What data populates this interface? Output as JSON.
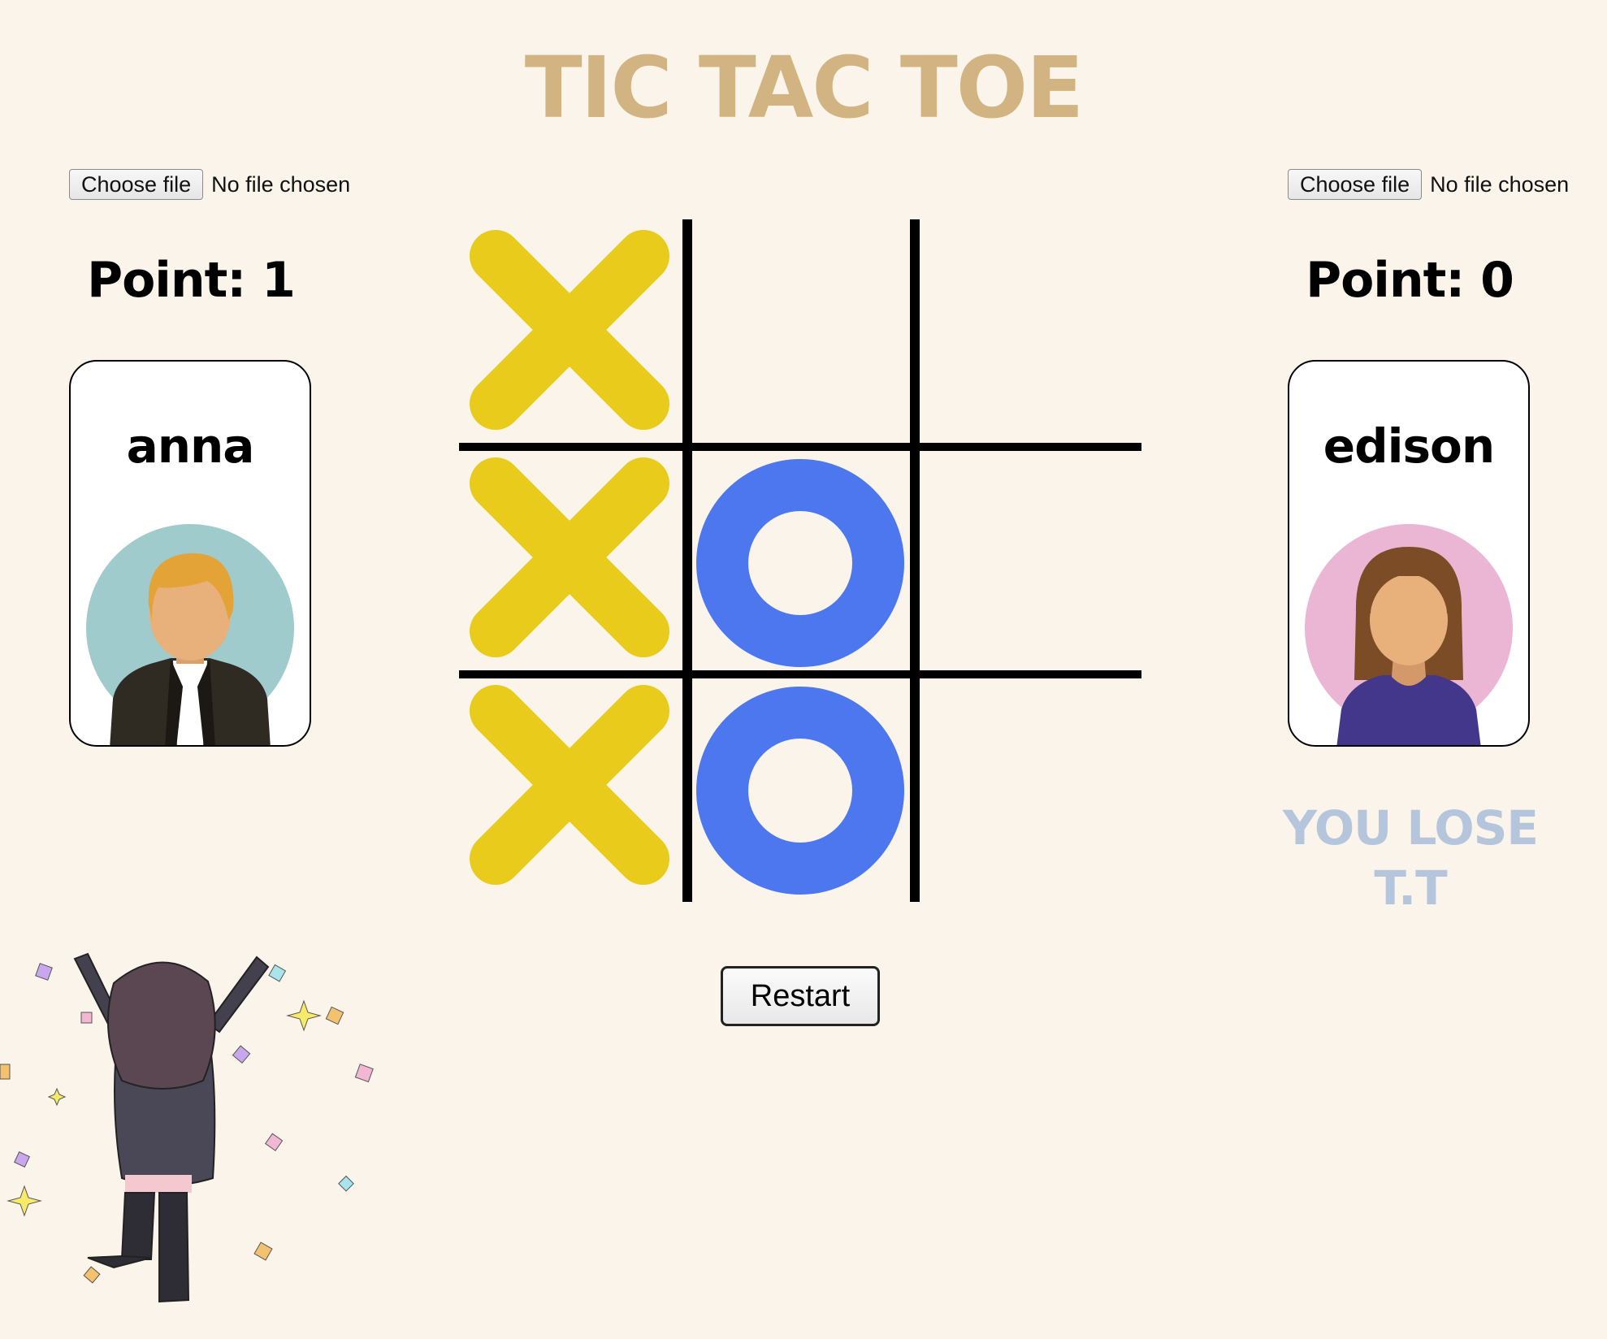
{
  "title": "TIC TAC TOE",
  "colors": {
    "background": "#faf4ea",
    "title": "#d2b483",
    "x_mark": "#e8cb1b",
    "o_mark": "#4c77ef",
    "result_text": "#b4c5dc"
  },
  "file_input": {
    "button_label": "Choose file",
    "status": "No file chosen"
  },
  "players": [
    {
      "name": "anna",
      "points_text": "Point: 1",
      "avatar": "male-avatar",
      "avatar_bg": "#a0cbcd"
    },
    {
      "name": "edison",
      "points_text": "Point: 0",
      "avatar": "female-avatar",
      "avatar_bg": "#ebb6d4",
      "result": [
        "YOU LOSE",
        "T.T"
      ]
    }
  ],
  "board": [
    [
      "X",
      "",
      ""
    ],
    [
      "X",
      "O",
      ""
    ],
    [
      "X",
      "O",
      ""
    ]
  ],
  "restart_label": "Restart",
  "decoration": "celebrating-girl-illustration"
}
